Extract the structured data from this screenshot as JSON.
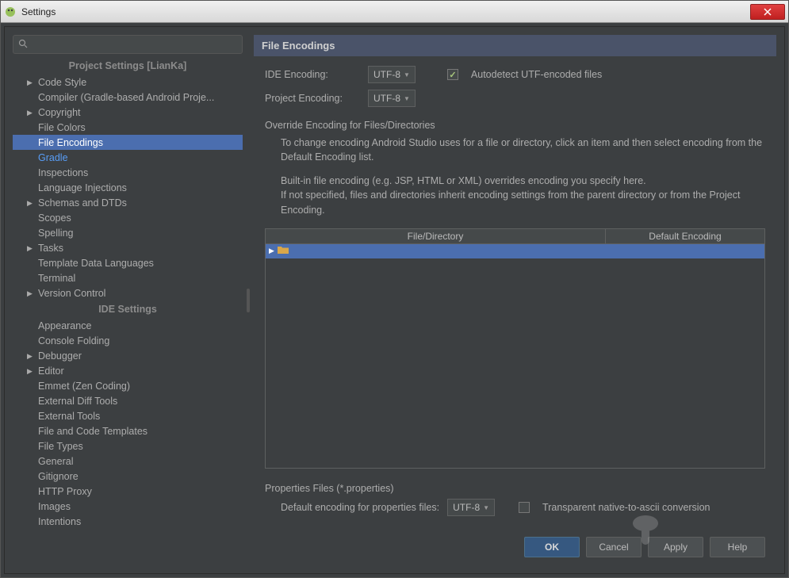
{
  "window": {
    "title": "Settings"
  },
  "search": {
    "placeholder": ""
  },
  "sidebar": {
    "header1": "Project Settings [LianKa]",
    "header2": "IDE Settings",
    "items1": [
      {
        "label": "Code Style",
        "expandable": true
      },
      {
        "label": "Compiler (Gradle-based Android Proje...",
        "expandable": false
      },
      {
        "label": "Copyright",
        "expandable": true
      },
      {
        "label": "File Colors",
        "expandable": false
      },
      {
        "label": "File Encodings",
        "expandable": false,
        "selected": true
      },
      {
        "label": "Gradle",
        "expandable": false,
        "highlighted": true
      },
      {
        "label": "Inspections",
        "expandable": false
      },
      {
        "label": "Language Injections",
        "expandable": false
      },
      {
        "label": "Schemas and DTDs",
        "expandable": true
      },
      {
        "label": "Scopes",
        "expandable": false
      },
      {
        "label": "Spelling",
        "expandable": false
      },
      {
        "label": "Tasks",
        "expandable": true
      },
      {
        "label": "Template Data Languages",
        "expandable": false
      },
      {
        "label": "Terminal",
        "expandable": false
      },
      {
        "label": "Version Control",
        "expandable": true
      }
    ],
    "items2": [
      {
        "label": "Appearance",
        "expandable": false
      },
      {
        "label": "Console Folding",
        "expandable": false
      },
      {
        "label": "Debugger",
        "expandable": true
      },
      {
        "label": "Editor",
        "expandable": true
      },
      {
        "label": "Emmet (Zen Coding)",
        "expandable": false
      },
      {
        "label": "External Diff Tools",
        "expandable": false
      },
      {
        "label": "External Tools",
        "expandable": false
      },
      {
        "label": "File and Code Templates",
        "expandable": false
      },
      {
        "label": "File Types",
        "expandable": false
      },
      {
        "label": "General",
        "expandable": false
      },
      {
        "label": "Gitignore",
        "expandable": false
      },
      {
        "label": "HTTP Proxy",
        "expandable": false
      },
      {
        "label": "Images",
        "expandable": false
      },
      {
        "label": "Intentions",
        "expandable": false
      }
    ]
  },
  "content": {
    "title": "File Encodings",
    "ide_encoding_label": "IDE Encoding:",
    "ide_encoding_value": "UTF-8",
    "project_encoding_label": "Project Encoding:",
    "project_encoding_value": "UTF-8",
    "autodetect_label": "Autodetect UTF-encoded files",
    "override_title": "Override Encoding for Files/Directories",
    "help1": "To change encoding Android Studio uses for a file or directory, click an item and then select encoding from the Default Encoding list.",
    "help2": "Built-in file encoding (e.g. JSP, HTML or XML) overrides encoding you specify here.",
    "help3": "If not specified, files and directories inherit encoding settings from the parent directory or from the Project Encoding.",
    "table": {
      "col1": "File/Directory",
      "col2": "Default Encoding",
      "rows": [
        {
          "path": ""
        }
      ]
    },
    "props_title": "Properties Files (*.properties)",
    "props_label": "Default encoding for properties files:",
    "props_value": "UTF-8",
    "transparent_label": "Transparent native-to-ascii conversion"
  },
  "buttons": {
    "ok": "OK",
    "cancel": "Cancel",
    "apply": "Apply",
    "help": "Help"
  }
}
